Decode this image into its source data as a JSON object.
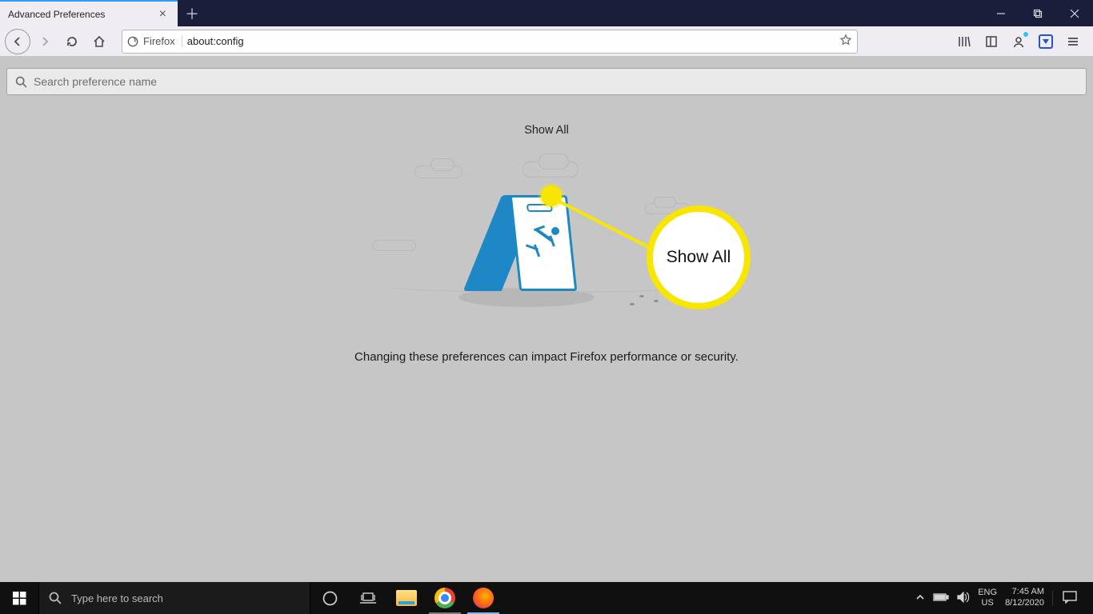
{
  "tab": {
    "title": "Advanced Preferences"
  },
  "address": {
    "identity": "Firefox",
    "url": "about:config"
  },
  "search": {
    "placeholder": "Search preference name"
  },
  "page": {
    "show_all": "Show All",
    "warning": "Changing these preferences can impact Firefox performance or security."
  },
  "callout": {
    "text": "Show All"
  },
  "taskbar": {
    "search_placeholder": "Type here to search",
    "lang_top": "ENG",
    "lang_bottom": "US",
    "time": "7:45 AM",
    "date": "8/12/2020"
  }
}
